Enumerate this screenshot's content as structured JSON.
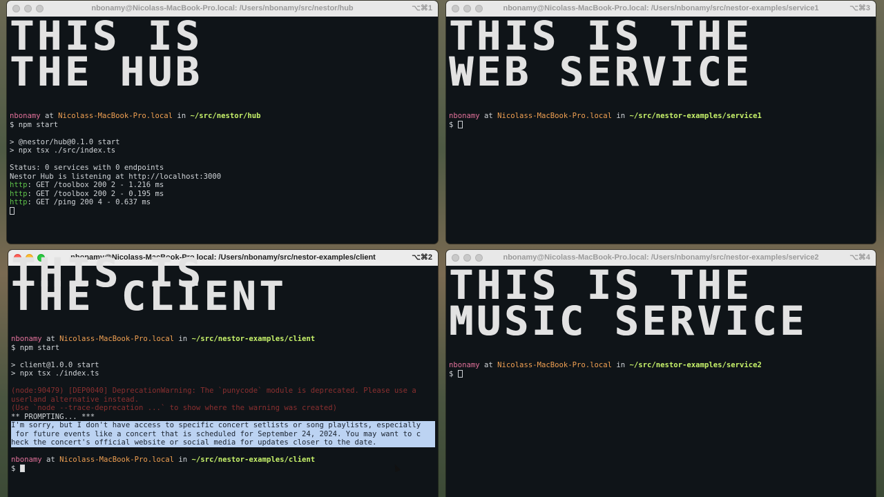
{
  "windows": {
    "hub": {
      "title": "nbonamy@Nicolass-MacBook-Pro.local: /Users/nbonamy/src/nestor/hub",
      "shortcut": "⌥⌘1",
      "banner1": "THIS IS",
      "banner2": "THE HUB",
      "prompt_user": "nbonamy",
      "prompt_at": " at ",
      "prompt_host": "Nicolass-MacBook-Pro.local",
      "prompt_in": " in ",
      "prompt_path": "~/src/nestor/hub",
      "cmd": "$ npm start",
      "out1": "> @nestor/hub@0.1.0 start",
      "out2": "> npx tsx ./src/index.ts",
      "status": "Status: 0 services with 0 endpoints",
      "listening": "Nestor Hub is listening at http://localhost:3000",
      "http_label": "http",
      "req1": ": GET /toolbox 200 2 - 1.216 ms",
      "req2": ": GET /toolbox 200 2 - 0.195 ms",
      "req3": ": GET /ping 200 4 - 0.637 ms"
    },
    "service1": {
      "title": "nbonamy@Nicolass-MacBook-Pro.local: /Users/nbonamy/src/nestor-examples/service1",
      "shortcut": "⌥⌘3",
      "banner1": "THIS IS THE",
      "banner2": "WEB SERVICE",
      "prompt_user": "nbonamy",
      "prompt_at": " at ",
      "prompt_host": "Nicolass-MacBook-Pro.local",
      "prompt_in": " in ",
      "prompt_path": "~/src/nestor-examples/service1",
      "dollar": "$ "
    },
    "client": {
      "title": "nbonamy@Nicolass-MacBook-Pro.local: /Users/nbonamy/src/nestor-examples/client",
      "shortcut": "⌥⌘2",
      "banner1": "THIS IS",
      "banner2": "THE CLIENT",
      "prompt_user": "nbonamy",
      "prompt_at": " at ",
      "prompt_host": "Nicolass-MacBook-Pro.local",
      "prompt_in": " in ",
      "prompt_path": "~/src/nestor-examples/client",
      "cmd": "$ npm start",
      "out1": "> client@1.0.0 start",
      "out2": "> npx tsx ./index.ts",
      "warn1": "(node:90479) [DEP0040] DeprecationWarning: The `punycode` module is deprecated. Please use a",
      "warn2": "userland alternative instead.",
      "warn3": "(Use `node --trace-deprecation ...` to show where the warning was created)",
      "prompting": "** PROMPTING... ***",
      "answer1": "I'm sorry, but I don't have access to specific concert setlists or song playlists, especially",
      "answer2": " for future events like a concert that is scheduled for September 24, 2024. You may want to c",
      "answer3": "heck the concert's official website or social media for updates closer to the date.",
      "dollar": "$ "
    },
    "service2": {
      "title": "nbonamy@Nicolass-MacBook-Pro.local: /Users/nbonamy/src/nestor-examples/service2",
      "shortcut": "⌥⌘4",
      "banner1": "THIS IS THE",
      "banner2": "MUSIC SERVICE",
      "prompt_user": "nbonamy",
      "prompt_at": " at ",
      "prompt_host": "Nicolass-MacBook-Pro.local",
      "prompt_in": " in ",
      "prompt_path": "~/src/nestor-examples/service2",
      "dollar": "$ "
    }
  },
  "colors": {
    "terminal_bg": "#0f1418",
    "user": "#e2719a",
    "host": "#f0a052",
    "path": "#c7f26a",
    "http": "#5ec24a",
    "selection": "#bcd3f2"
  }
}
